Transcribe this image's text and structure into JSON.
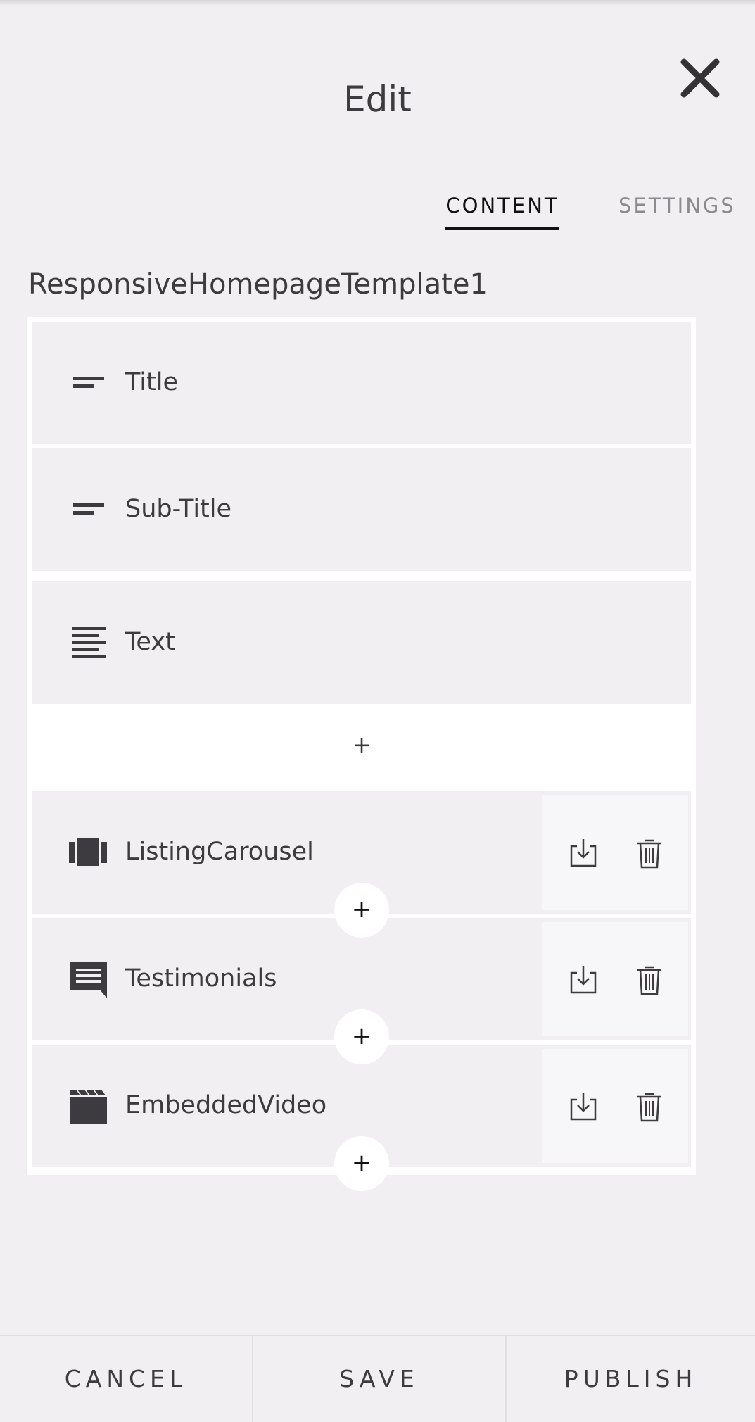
{
  "header": {
    "title": "Edit",
    "close_icon": "close-icon"
  },
  "tabs": [
    {
      "label": "CONTENT",
      "active": true
    },
    {
      "label": "SETTINGS",
      "active": false
    }
  ],
  "template_name": "ResponsiveHomepageTemplate1",
  "blocks": [
    {
      "label": "Title",
      "icon": "short-text-icon"
    },
    {
      "label": "Sub-Title",
      "icon": "short-text-icon"
    },
    {
      "label": "Text",
      "icon": "paragraph-text-icon"
    },
    {
      "label": "ListingCarousel",
      "icon": "carousel-icon"
    },
    {
      "label": "Testimonials",
      "icon": "chat-bubble-icon"
    },
    {
      "label": "EmbeddedVideo",
      "icon": "clapperboard-icon"
    }
  ],
  "add_label": "+",
  "footer": {
    "cancel": "CANCEL",
    "save": "SAVE",
    "publish": "PUBLISH"
  },
  "colors": {
    "background": "#f1eff2",
    "panel": "#ffffff",
    "text": "#3d3b3f",
    "active_tab": "#111111",
    "inactive_tab": "#8c8a8e"
  }
}
